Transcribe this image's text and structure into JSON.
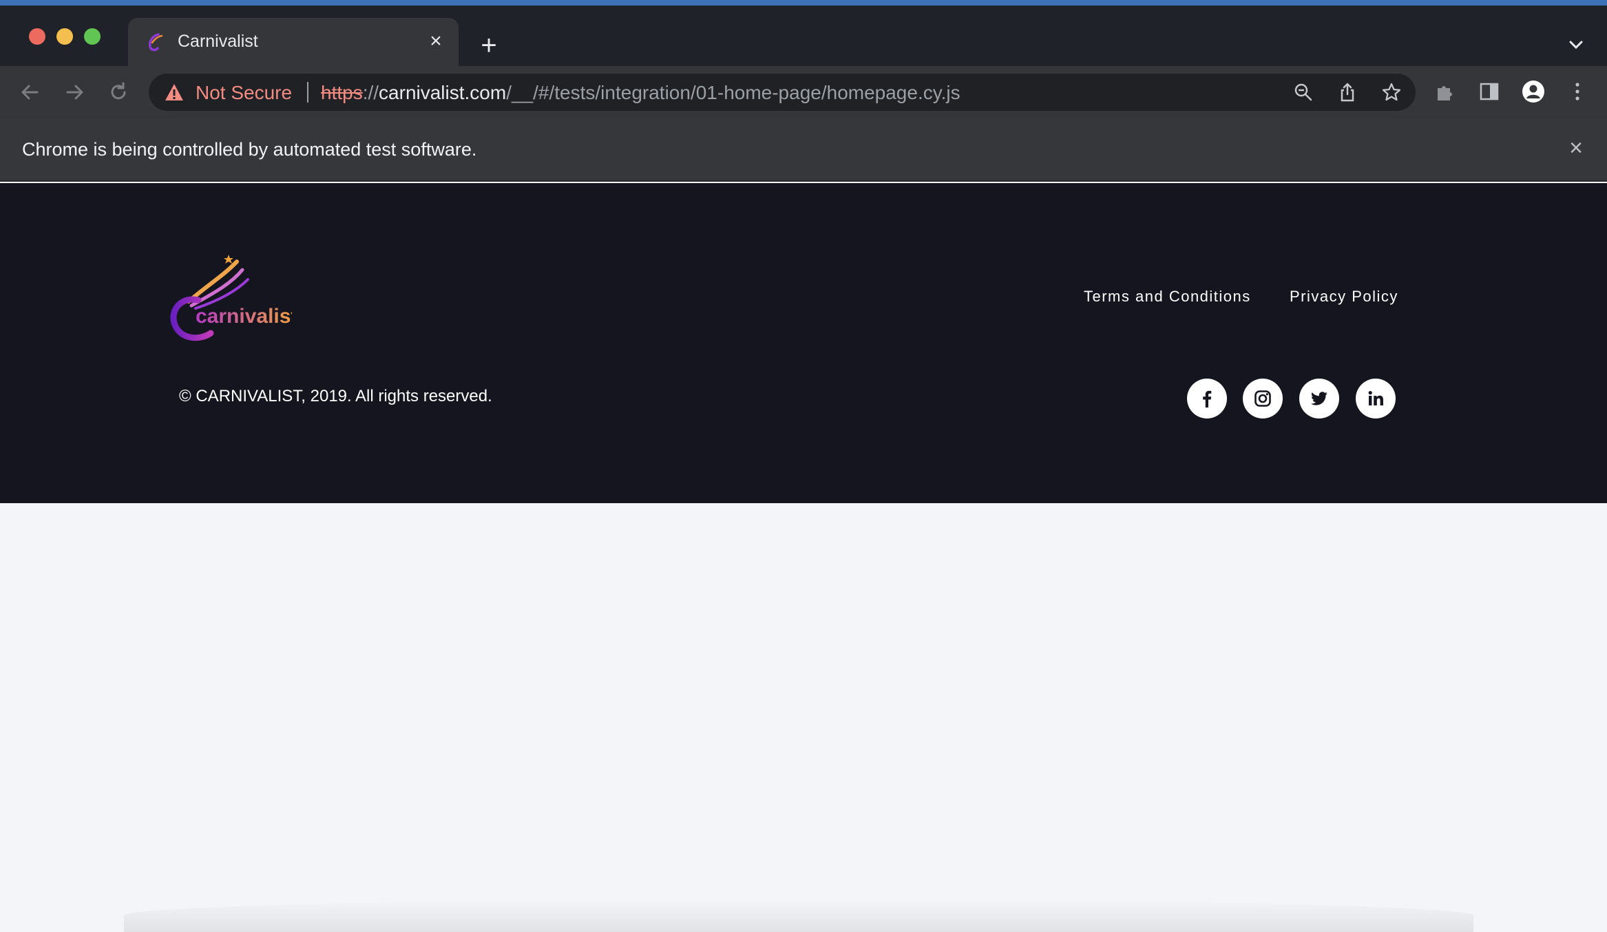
{
  "browser": {
    "tab": {
      "title": "Carnivalist",
      "favicon": "carnivalist-favicon"
    },
    "address_bar": {
      "security_label": "Not Secure",
      "url_scheme": "https",
      "url_scheme_sep": "://",
      "url_host": "carnivalist.com",
      "url_path": "/__/#/tests/integration/01-home-page/homepage.cy.js"
    },
    "infobar": {
      "message": "Chrome is being controlled by automated test software."
    }
  },
  "footer": {
    "logo_text": "carnivalist",
    "links": {
      "terms": "Terms and Conditions",
      "privacy": "Privacy Policy"
    },
    "copyright": "© CARNIVALIST, 2019. All rights reserved.",
    "social": [
      "facebook-icon",
      "instagram-icon",
      "twitter-icon",
      "linkedin-icon"
    ]
  },
  "colors": {
    "footer_bg": "#14151f",
    "page_bg": "#f4f5f9",
    "warning": "#f28b82",
    "brand_purple": "#7b2fc9",
    "brand_orange": "#f29a3c"
  }
}
